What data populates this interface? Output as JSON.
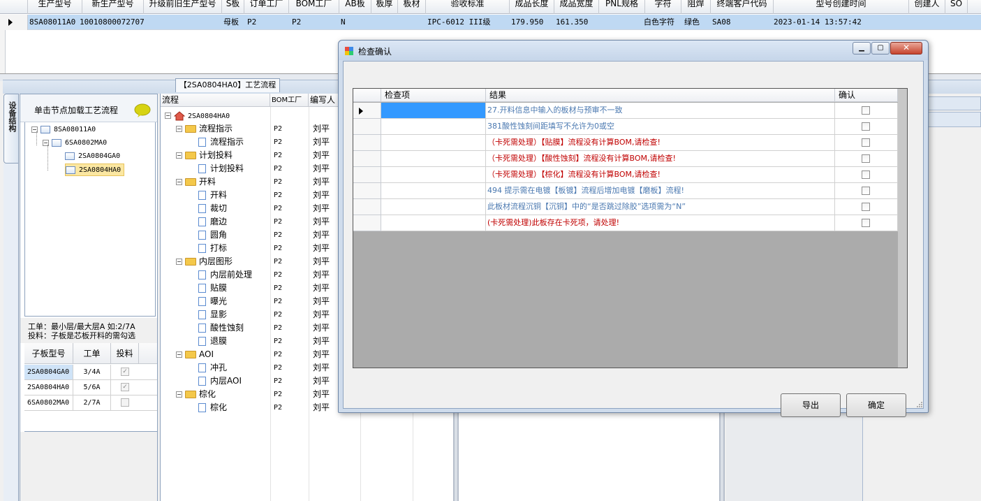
{
  "top_grid": {
    "headers": [
      "生产型号",
      "新生产型号",
      "升级前旧生产型号",
      "S板",
      "订单工厂",
      "BOM工厂",
      "AB板",
      "板厚",
      "板材",
      "验收标准",
      "成品长度",
      "成品宽度",
      "PNL规格",
      "字符",
      "阻焊",
      "终端客户代码",
      "型号创建时间",
      "创建人",
      "SO"
    ],
    "row": {
      "model": "8SA08011A0",
      "new_model": "10010800072707",
      "old_model": "",
      "s_board": "母板",
      "order_factory": "P2",
      "bom_factory": "P2",
      "ab_board": "N",
      "thickness": "",
      "material": "",
      "standard": "IPC-6012 III级",
      "length": "179.950",
      "width": "161.350",
      "pnl": "",
      "character": "白色字符",
      "solder_mask": "绿色",
      "customer_code": "SA08",
      "created_time": "2023-01-14 13:57:42"
    }
  },
  "process_tab": "【2SA0804HA0】工艺流程",
  "side_tab": "设备结构",
  "left_panel": {
    "title": "单击节点加载工艺流程",
    "tree": [
      {
        "label": "8SA08011A0",
        "selected": false
      },
      {
        "label": "6SA0802MA0",
        "selected": false
      },
      {
        "label": "2SA0804GA0",
        "selected": false
      },
      {
        "label": "2SA0804HA0",
        "selected": true
      }
    ],
    "note1": "工单：最小层/最大层A 如:2/7A",
    "note2": "投料：子板是芯板开料的需勾选",
    "table_headers": [
      "子板型号",
      "工单",
      "投料"
    ],
    "rows": [
      {
        "model": "2SA0804GA0",
        "order": "3/4A",
        "checked": true
      },
      {
        "model": "2SA0804HA0",
        "order": "5/6A",
        "checked": true
      },
      {
        "model": "6SA0802MA0",
        "order": "2/7A",
        "checked": false
      }
    ]
  },
  "process_tree": {
    "headers": [
      "流程",
      "BOM工厂",
      "编写人"
    ],
    "root": "2SA0804HA0",
    "nodes": [
      {
        "label": "流程指示",
        "folder": true,
        "bom": "P2",
        "writer": "刘平"
      },
      {
        "label": "流程指示",
        "folder": false,
        "bom": "P2",
        "writer": "刘平"
      },
      {
        "label": "计划投料",
        "folder": true,
        "bom": "P2",
        "writer": "刘平"
      },
      {
        "label": "计划投料",
        "folder": false,
        "bom": "P2",
        "writer": "刘平"
      },
      {
        "label": "开料",
        "folder": true,
        "bom": "P2",
        "writer": "刘平"
      },
      {
        "label": "开料",
        "folder": false,
        "bom": "P2",
        "writer": "刘平"
      },
      {
        "label": "裁切",
        "folder": false,
        "bom": "P2",
        "writer": "刘平"
      },
      {
        "label": "磨边",
        "folder": false,
        "bom": "P2",
        "writer": "刘平"
      },
      {
        "label": "圆角",
        "folder": false,
        "bom": "P2",
        "writer": "刘平"
      },
      {
        "label": "打标",
        "folder": false,
        "bom": "P2",
        "writer": "刘平"
      },
      {
        "label": "内层图形",
        "folder": true,
        "bom": "P2",
        "writer": "刘平"
      },
      {
        "label": "内层前处理",
        "folder": false,
        "bom": "P2",
        "writer": "刘平"
      },
      {
        "label": "贴膜",
        "folder": false,
        "bom": "P2",
        "writer": "刘平"
      },
      {
        "label": "曝光",
        "folder": false,
        "bom": "P2",
        "writer": "刘平"
      },
      {
        "label": "显影",
        "folder": false,
        "bom": "P2",
        "writer": "刘平"
      },
      {
        "label": "酸性蚀刻",
        "folder": false,
        "bom": "P2",
        "writer": "刘平"
      },
      {
        "label": "退膜",
        "folder": false,
        "bom": "P2",
        "writer": "刘平"
      },
      {
        "label": "AOI",
        "folder": true,
        "bom": "P2",
        "writer": "刘平"
      },
      {
        "label": "冲孔",
        "folder": false,
        "bom": "P2",
        "writer": "刘平"
      },
      {
        "label": "内层AOI",
        "folder": false,
        "bom": "P2",
        "writer": "刘平"
      },
      {
        "label": "棕化",
        "folder": true,
        "bom": "P2",
        "writer": "刘平"
      },
      {
        "label": "棕化",
        "folder": false,
        "bom": "P2",
        "writer": "刘平"
      }
    ]
  },
  "dialog": {
    "title": "检查确认",
    "headers": [
      "检查项",
      "结果",
      "确认"
    ],
    "rows": [
      {
        "item": "",
        "result": "27.开料信息中输入的板材与预审不一致",
        "color": "#4a78b0",
        "confirmed": false
      },
      {
        "item": "",
        "result": "381酸性蚀刻间距填写不允许为0或空",
        "color": "#4a78b0",
        "confirmed": false
      },
      {
        "item": "",
        "result": "（卡死需处理）【贴膜】流程没有计算BOM,请检查!",
        "color": "#c00000",
        "confirmed": false
      },
      {
        "item": "",
        "result": "（卡死需处理）【酸性蚀刻】流程没有计算BOM,请检查!",
        "color": "#c00000",
        "confirmed": false
      },
      {
        "item": "",
        "result": "（卡死需处理）【棕化】流程没有计算BOM,请检查!",
        "color": "#c00000",
        "confirmed": false
      },
      {
        "item": "",
        "result": "494 提示需在电镀【板镀】流程后增加电镀【磨板】流程!",
        "color": "#4a78b0",
        "confirmed": false
      },
      {
        "item": "",
        "result": "此板材流程沉铜【沉铜】中的“是否跳过除胶”选项需为“N”",
        "color": "#4a78b0",
        "confirmed": false
      },
      {
        "item": "",
        "result": "(卡死需处理)此板存在卡死项，请处理!",
        "color": "#c00000",
        "confirmed": false
      }
    ],
    "export_label": "导出",
    "ok_label": "确定"
  }
}
